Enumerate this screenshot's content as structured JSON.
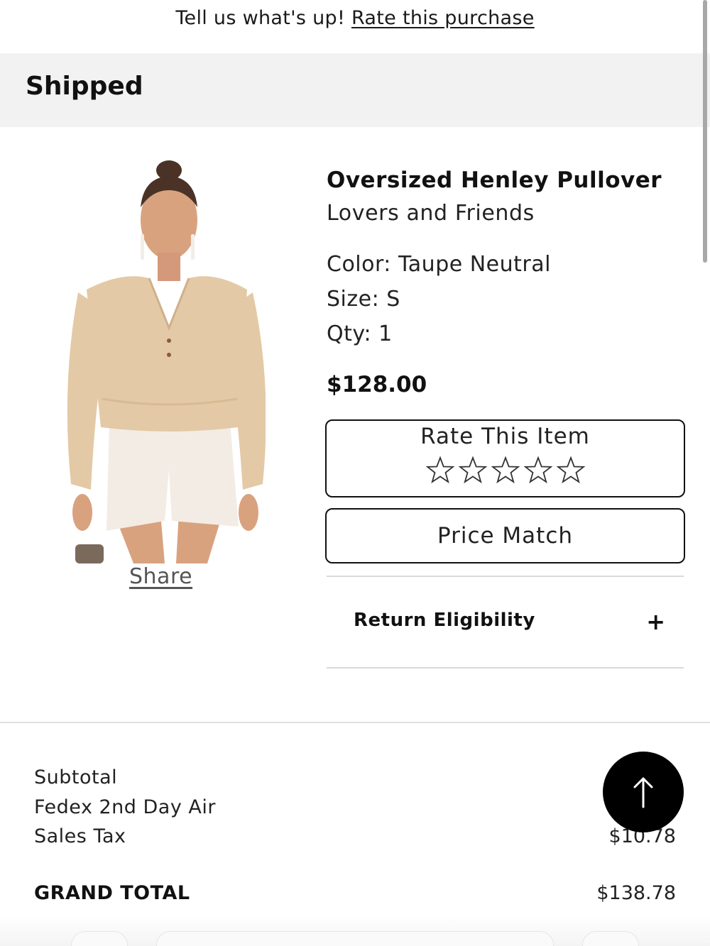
{
  "banner": {
    "prefix": "Tell us what's up!",
    "link": "Rate this purchase"
  },
  "order": {
    "status": "Shipped"
  },
  "product": {
    "title": "Oversized Henley Pullover",
    "brand": "Lovers and Friends",
    "color": "Color: Taupe Neutral",
    "size": "Size: S",
    "qty": "Qty: 1",
    "price": "$128.00",
    "share_label": "Share",
    "image_colors": {
      "top": "#e3c9a5",
      "shorts": "#f3ece5",
      "skin": "#d9a27f",
      "hair": "#4a3326"
    }
  },
  "actions": {
    "rate_label": "Rate This Item",
    "rating_stars_total": 5,
    "rating_value": 0,
    "price_match_label": "Price Match",
    "return_label": "Return Eligibility",
    "return_toggle": "+"
  },
  "summary": {
    "subtotal_label": "Subtotal",
    "subtotal_value": "$",
    "shipping_label": "Fedex 2nd Day Air",
    "shipping_value": "",
    "tax_label": "Sales Tax",
    "tax_value": "$10.78",
    "grand_total_label": "GRAND TOTAL",
    "grand_total_value": "$138.78"
  },
  "icons": {
    "back_to_top": "arrow-up-icon",
    "star": "star-outline-icon"
  }
}
